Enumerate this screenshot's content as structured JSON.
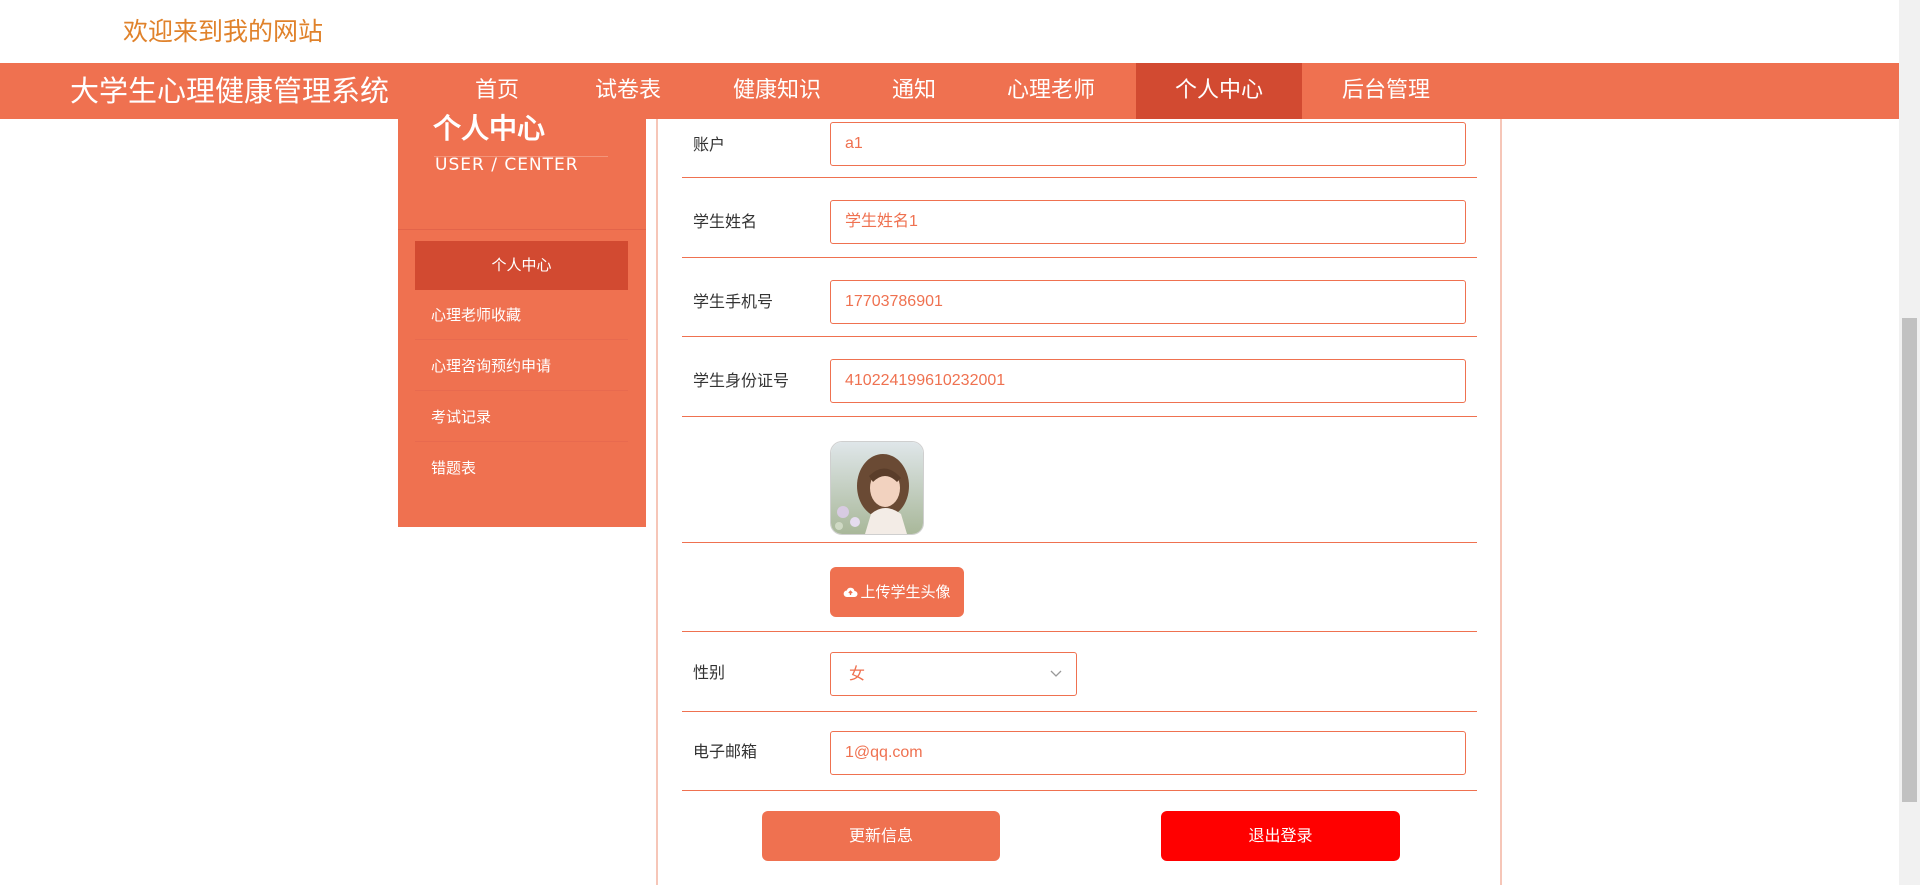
{
  "header": {
    "welcome": "欢迎来到我的网站"
  },
  "nav": {
    "brand": "大学生心理健康管理系统",
    "items": [
      {
        "label": "首页"
      },
      {
        "label": "试卷表"
      },
      {
        "label": "健康知识"
      },
      {
        "label": "通知"
      },
      {
        "label": "心理老师"
      },
      {
        "label": "个人中心",
        "active": true
      },
      {
        "label": "后台管理"
      }
    ]
  },
  "sidebar": {
    "title": "个人中心",
    "subtitle": "USER / CENTER",
    "items": [
      {
        "label": "个人中心",
        "active": true
      },
      {
        "label": "心理老师收藏"
      },
      {
        "label": "心理咨询预约申请"
      },
      {
        "label": "考试记录"
      },
      {
        "label": "错题表"
      }
    ]
  },
  "form": {
    "account": {
      "label": "账户",
      "value": "a1"
    },
    "name": {
      "label": "学生姓名",
      "value": "学生姓名1"
    },
    "phone": {
      "label": "学生手机号",
      "value": "17703786901"
    },
    "id_card": {
      "label": "学生身份证号",
      "value": "410224199610232001"
    },
    "upload_button": "上传学生头像",
    "gender": {
      "label": "性别",
      "value": "女"
    },
    "email": {
      "label": "电子邮箱",
      "value": "1@qq.com"
    },
    "update_button": "更新信息",
    "logout_button": "退出登录"
  },
  "colors": {
    "accent": "#ef7150",
    "accent_dark": "#d24a31",
    "danger": "#ff0000",
    "welcome": "#e0822b"
  }
}
